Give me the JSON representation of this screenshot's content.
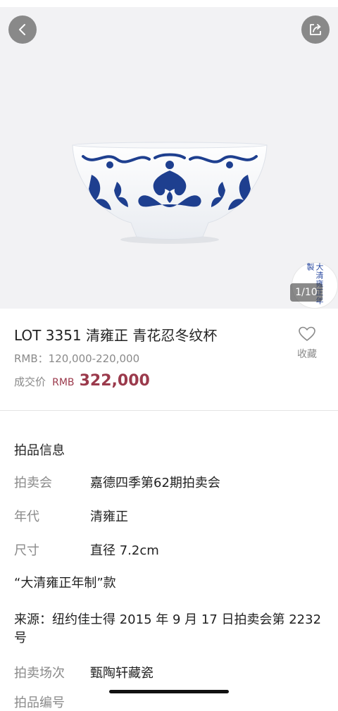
{
  "gallery": {
    "counter": "1/10",
    "seal_text": "大清雍正年製"
  },
  "lot": {
    "title": "LOT 3351 清雍正 青花忍冬纹杯",
    "estimate": "RMB：120,000-220,000",
    "hammer_label": "成交价",
    "hammer_currency": "RMB",
    "hammer_price": "322,000",
    "favorite_label": "收藏"
  },
  "info": {
    "section_title": "拍品信息",
    "auction_key": "拍卖会",
    "auction_value": "嘉德四季第62期拍卖会",
    "period_key": "年代",
    "period_value": "清雍正",
    "size_key": "尺寸",
    "size_value": "直径 7.2cm",
    "mark_text": "“大清雍正年制”款",
    "provenance_text": "来源：纽约佳士得 2015 年 9 月 17 日拍卖会第 2232 号",
    "session_key": "拍卖场次",
    "session_value": "甄陶轩藏瓷",
    "cut_text": "拍品编号"
  },
  "colors": {
    "accent_price": "#9b3a4c",
    "muted_text": "#8a8a8a",
    "cobalt": "#1e3f8f"
  },
  "icons": [
    "back-arrow-icon",
    "share-icon",
    "heart-icon"
  ]
}
